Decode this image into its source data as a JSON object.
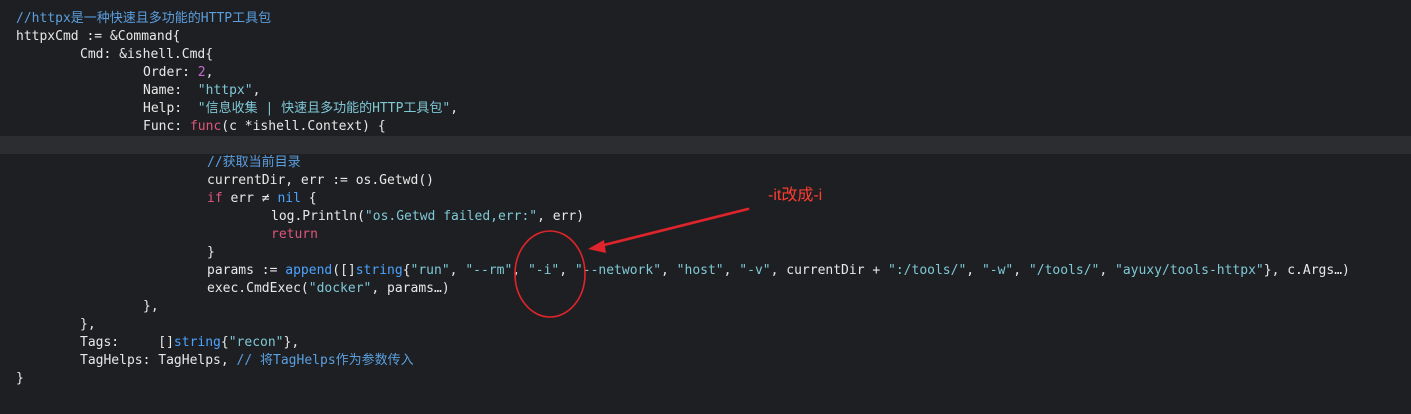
{
  "editor": {
    "lines": [
      [
        {
          "t": "//httpx是一种快速且多功能的HTTP工具包",
          "c": "comment"
        }
      ],
      [
        {
          "t": "httpxCmd := &Command{",
          "c": "plain"
        }
      ],
      [
        {
          "t": "Cmd: &ishell.Cmd{",
          "c": "plain"
        }
      ],
      [
        {
          "t": "Order: ",
          "c": "plain"
        },
        {
          "t": "2",
          "c": "number"
        },
        {
          "t": ",",
          "c": "plain"
        }
      ],
      [
        {
          "t": "Name:  ",
          "c": "plain"
        },
        {
          "t": "\"httpx\"",
          "c": "string"
        },
        {
          "t": ",",
          "c": "plain"
        }
      ],
      [
        {
          "t": "Help:  ",
          "c": "plain"
        },
        {
          "t": "\"信息收集 | 快速且多功能的HTTP工具包\"",
          "c": "string"
        },
        {
          "t": ",",
          "c": "plain"
        }
      ],
      [
        {
          "t": "Func: ",
          "c": "plain"
        },
        {
          "t": "func",
          "c": "keyword"
        },
        {
          "t": "(c *ishell.Context) {",
          "c": "plain"
        }
      ],
      [],
      [
        {
          "t": "//获取当前目录",
          "c": "comment"
        }
      ],
      [
        {
          "t": "currentDir, err := os.Getwd()",
          "c": "plain"
        }
      ],
      [
        {
          "t": "if",
          "c": "keyword"
        },
        {
          "t": " err ≠ ",
          "c": "plain"
        },
        {
          "t": "nil",
          "c": "type"
        },
        {
          "t": " {",
          "c": "plain"
        }
      ],
      [
        {
          "t": "log.Println(",
          "c": "plain"
        },
        {
          "t": "\"os.Getwd failed,err:\"",
          "c": "string"
        },
        {
          "t": ", err)",
          "c": "plain"
        }
      ],
      [
        {
          "t": "return",
          "c": "keyword"
        }
      ],
      [
        {
          "t": "}",
          "c": "plain"
        }
      ],
      [
        {
          "t": "params := ",
          "c": "plain"
        },
        {
          "t": "append",
          "c": "type"
        },
        {
          "t": "([]",
          "c": "plain"
        },
        {
          "t": "string",
          "c": "type"
        },
        {
          "t": "{",
          "c": "plain"
        },
        {
          "t": "\"run\"",
          "c": "string"
        },
        {
          "t": ", ",
          "c": "plain"
        },
        {
          "t": "\"--rm\"",
          "c": "string"
        },
        {
          "t": ", ",
          "c": "plain"
        },
        {
          "t": "\"-i\"",
          "c": "string"
        },
        {
          "t": ", ",
          "c": "plain"
        },
        {
          "t": "\"--network\"",
          "c": "string"
        },
        {
          "t": ", ",
          "c": "plain"
        },
        {
          "t": "\"host\"",
          "c": "string"
        },
        {
          "t": ", ",
          "c": "plain"
        },
        {
          "t": "\"-v\"",
          "c": "string"
        },
        {
          "t": ", currentDir + ",
          "c": "plain"
        },
        {
          "t": "\":/tools/\"",
          "c": "string"
        },
        {
          "t": ", ",
          "c": "plain"
        },
        {
          "t": "\"-w\"",
          "c": "string"
        },
        {
          "t": ", ",
          "c": "plain"
        },
        {
          "t": "\"/tools/\"",
          "c": "string"
        },
        {
          "t": ", ",
          "c": "plain"
        },
        {
          "t": "\"ayuxy/tools-httpx\"",
          "c": "string"
        },
        {
          "t": "}, c.Args…)",
          "c": "plain"
        }
      ],
      [
        {
          "t": "exec.CmdExec(",
          "c": "plain"
        },
        {
          "t": "\"docker\"",
          "c": "string"
        },
        {
          "t": ", params…)",
          "c": "plain"
        }
      ],
      [
        {
          "t": "},",
          "c": "plain"
        }
      ],
      [
        {
          "t": "},",
          "c": "plain"
        }
      ],
      [
        {
          "t": "Tags:     []",
          "c": "plain"
        },
        {
          "t": "string",
          "c": "type"
        },
        {
          "t": "{",
          "c": "plain"
        },
        {
          "t": "\"recon\"",
          "c": "string"
        },
        {
          "t": "},",
          "c": "plain"
        }
      ],
      [
        {
          "t": "TagHelps: TagHelps, ",
          "c": "plain"
        },
        {
          "t": "// 将TagHelps作为参数传入",
          "c": "comment"
        }
      ],
      [
        {
          "t": "}",
          "c": "plain"
        }
      ]
    ],
    "indents": [
      0,
      0,
      1,
      2,
      2,
      2,
      2,
      3,
      3,
      3,
      3,
      4,
      4,
      3,
      3,
      3,
      2,
      1,
      1,
      1,
      0
    ],
    "current_line_index": 7
  },
  "annotation": {
    "label": "-it改成-i",
    "color": "#ff3b30"
  },
  "colors": {
    "background": "#1e1f22",
    "current_line": "#2c2d31",
    "comment": "#5b9fe0",
    "string": "#7ec8d6",
    "keyword": "#e0567a",
    "number": "#c96ad8",
    "type": "#4ba3ff",
    "plain": "#e8e8e8"
  }
}
